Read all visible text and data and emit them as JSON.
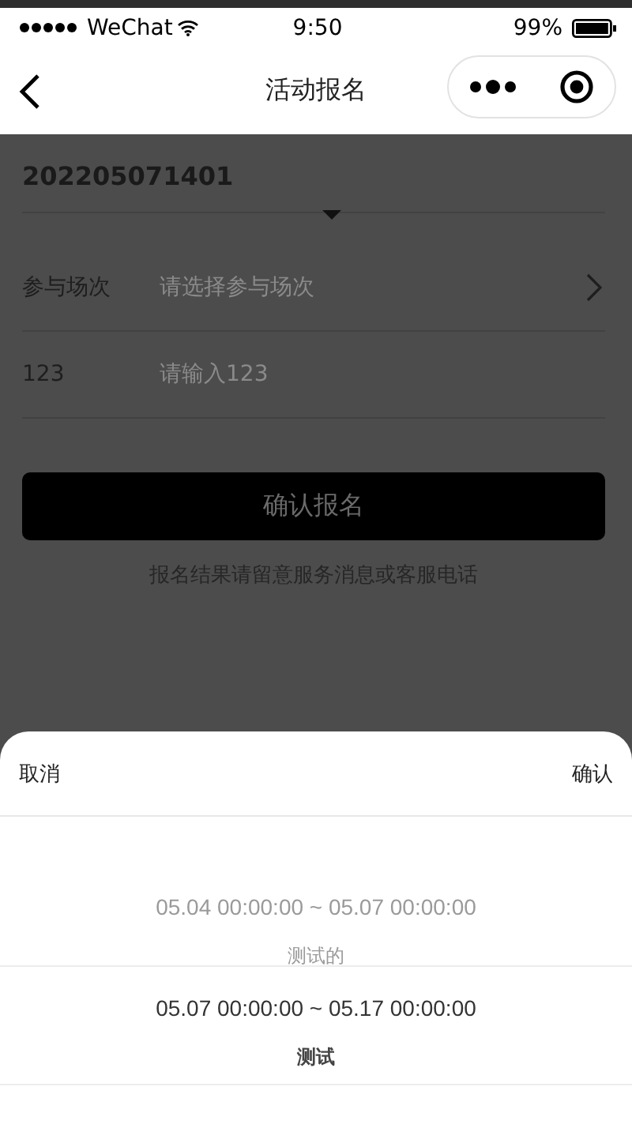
{
  "status_bar": {
    "carrier": "WeChat",
    "time": "9:50",
    "battery": "99%"
  },
  "nav": {
    "title": "活动报名"
  },
  "form": {
    "title": "202205071401",
    "rows": [
      {
        "kind": "select",
        "label": "参与场次",
        "placeholder": "请选择参与场次"
      },
      {
        "kind": "input",
        "label": "123",
        "placeholder": "请输入123"
      }
    ],
    "submit": "确认报名",
    "note": "报名结果请留意服务消息或客服电话"
  },
  "sheet": {
    "cancel": "取消",
    "confirm": "确认",
    "options": [
      {
        "time": "05.04 00:00:00 ~ 05.07 00:00:00",
        "name": "测试的",
        "selected": false
      },
      {
        "time": "05.07 00:00:00 ~ 05.17 00:00:00",
        "name": "测试",
        "selected": true
      }
    ]
  }
}
